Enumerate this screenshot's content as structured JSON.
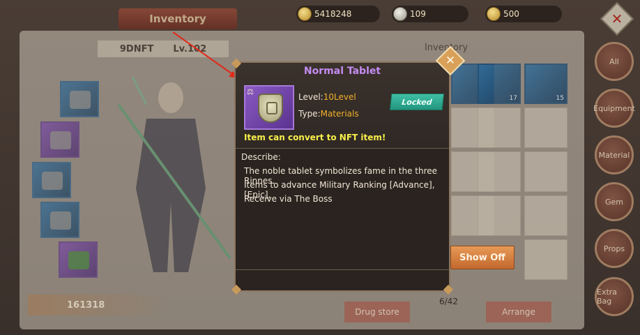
{
  "top_bar": {
    "title": "Inventory",
    "currencies": [
      {
        "icon": "gold-coin-icon",
        "value": "5418248"
      },
      {
        "icon": "silver-coin-icon",
        "value": "109"
      },
      {
        "icon": "gold-token-icon",
        "value": "500"
      }
    ]
  },
  "character": {
    "name": "9DNFT",
    "level": "Lv.102",
    "power": "161318"
  },
  "inventory": {
    "tab_label": "Inventory",
    "item_counts": [
      "17",
      "15"
    ],
    "page": "6/42"
  },
  "side_tabs": [
    "All",
    "Equipment",
    "Material",
    "Gem",
    "Props",
    "Extra Bag"
  ],
  "buttons": {
    "show_off": "Show Off",
    "drug_store": "Drug store",
    "arrange": "Arrange"
  },
  "popup": {
    "title": "Normal Tablet",
    "level_label": "Level:",
    "level_value": "10Level",
    "type_label": "Type:",
    "type_value": "Materials",
    "status": "Locked",
    "nft_note": "Item can convert to NFT item!",
    "describe_label": "Describe:",
    "description": [
      "The noble tablet symbolizes fame in the three Rinnes.",
      "Items to advance Military Ranking [Advance], [Epic],",
      "Receive via The Boss"
    ]
  },
  "colors": {
    "rarity_purple": "#c48cf2",
    "value_gold": "#f2b02a",
    "nft_yellow": "#f8ee4a",
    "locked_teal": "#3fc0a6",
    "arrow_red": "#e02a1a"
  }
}
